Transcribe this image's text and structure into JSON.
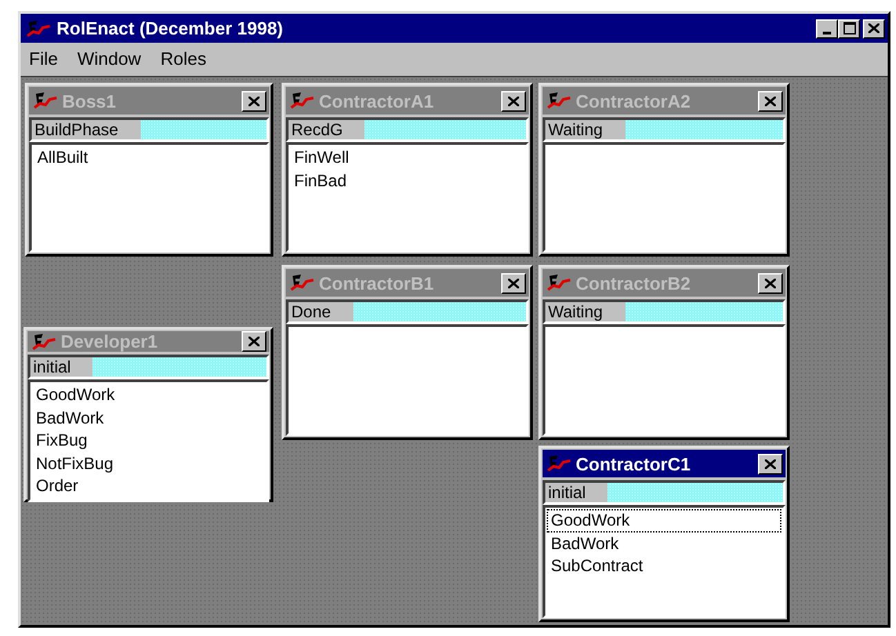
{
  "window": {
    "title": "RolEnact (December 1998)"
  },
  "menu": [
    "File",
    "Window",
    "Roles"
  ],
  "windows": [
    {
      "title": "Boss1",
      "active": false,
      "state": "BuildPhase",
      "items": [
        {
          "label": "AllBuilt",
          "focused": false
        }
      ]
    },
    {
      "title": "ContractorA1",
      "active": false,
      "state": "RecdG",
      "items": [
        {
          "label": "FinWell",
          "focused": false
        },
        {
          "label": "FinBad",
          "focused": false
        }
      ]
    },
    {
      "title": "ContractorA2",
      "active": false,
      "state": "Waiting"
    },
    {
      "title": "ContractorB1",
      "active": false,
      "state": "Done"
    },
    {
      "title": "ContractorB2",
      "active": false,
      "state": "Waiting"
    },
    {
      "title": "Developer1",
      "active": false,
      "state": "initial",
      "items": [
        {
          "label": "GoodWork",
          "focused": false
        },
        {
          "label": "BadWork",
          "focused": false
        },
        {
          "label": "FixBug",
          "focused": false
        },
        {
          "label": "NotFixBug",
          "focused": false
        },
        {
          "label": "Order",
          "focused": false
        }
      ]
    },
    {
      "title": "ContractorC1",
      "active": true,
      "state": "initial",
      "items": [
        {
          "label": "GoodWork",
          "focused": true
        },
        {
          "label": "BadWork",
          "focused": false
        },
        {
          "label": "SubContract",
          "focused": false
        }
      ]
    }
  ]
}
